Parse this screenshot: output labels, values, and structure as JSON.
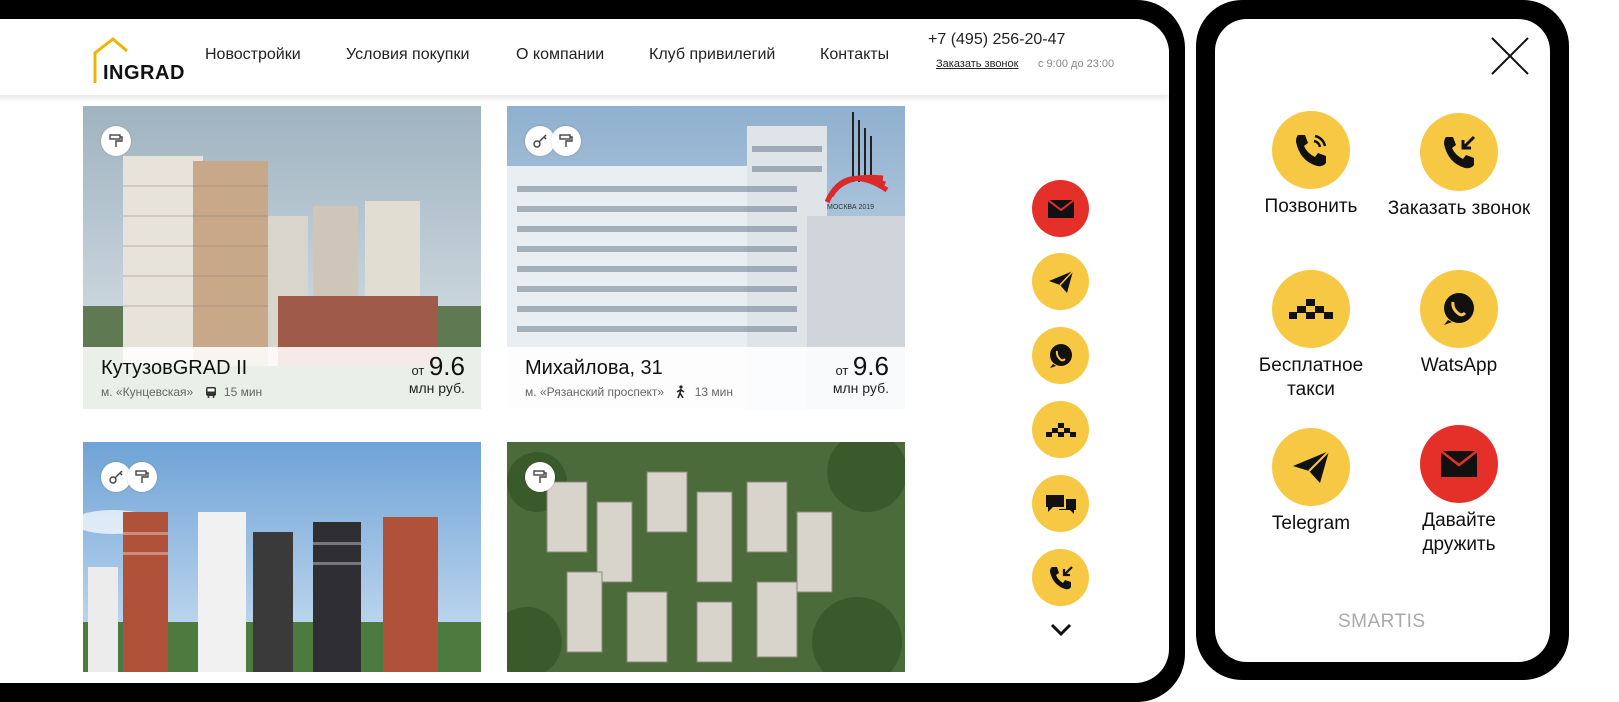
{
  "header": {
    "logo_text": "INGRAD",
    "nav": [
      "Новостройки",
      "Условия покупки",
      "О компании",
      "Клуб привилегий",
      "Контакты"
    ],
    "phone": "+7 (495) 256-20-47",
    "callback_label": "Заказать звонок",
    "hours": "с 9:00 до 23:00"
  },
  "cards": [
    {
      "title": "КутузовGRAD II",
      "metro": "м. «Кунцевская»",
      "transport_icon": "bus-icon",
      "minutes": "15 мин",
      "price_from": "от",
      "price": "9.6",
      "price_unit": "млн руб.",
      "badges": [
        "paint-roller-icon"
      ]
    },
    {
      "title": "Михайлова, 31",
      "metro": "м. «Рязанский проспект»",
      "transport_icon": "walking-icon",
      "minutes": "13 мин",
      "price_from": "от",
      "price": "9.6",
      "price_unit": "млн руб.",
      "badges": [
        "key-icon",
        "paint-roller-icon"
      ],
      "award_text": "МОСКВА 2019"
    },
    {
      "badges": [
        "key-icon",
        "paint-roller-icon"
      ]
    },
    {
      "badges": [
        "paint-roller-icon"
      ]
    }
  ],
  "widget_buttons": [
    "email-icon",
    "telegram-icon",
    "whatsapp-icon",
    "taxi-icon",
    "chat-icon",
    "callback-icon"
  ],
  "panel": {
    "items": [
      {
        "label": "Позвонить",
        "icon": "phone-call-icon",
        "color": "#f7c844"
      },
      {
        "label": "Заказать звонок",
        "icon": "callback-icon",
        "color": "#f7c844"
      },
      {
        "label": "Бесплатное такси",
        "icon": "taxi-icon",
        "color": "#f7c844"
      },
      {
        "label": "WatsApp",
        "icon": "whatsapp-icon",
        "color": "#f7c844"
      },
      {
        "label": "Telegram",
        "icon": "telegram-icon",
        "color": "#f7c844"
      },
      {
        "label": "Давайте дружить",
        "icon": "email-icon",
        "color": "#e5302a"
      }
    ],
    "brand": "SMARTIS"
  },
  "colors": {
    "accent": "#f7c844",
    "alert": "#e5302a"
  }
}
